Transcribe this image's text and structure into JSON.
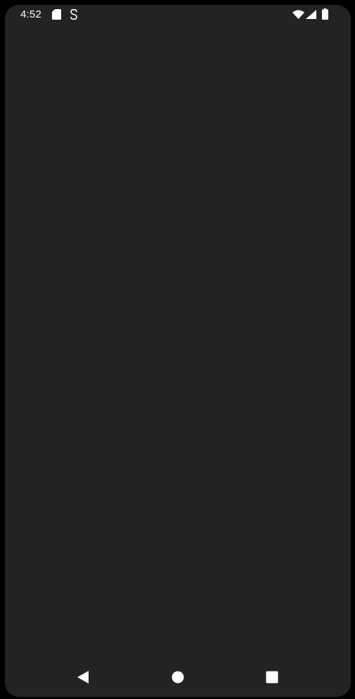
{
  "status_bar": {
    "time": "4:52",
    "left_icons": [
      "sd-card-icon",
      "sync-icon"
    ],
    "right_icons": [
      "wifi-icon",
      "cell-signal-icon",
      "battery-icon"
    ]
  },
  "nav_bar": {
    "buttons": [
      "back-icon",
      "home-icon",
      "recents-icon"
    ]
  },
  "colors": {
    "screen_background": "#232323",
    "frame": "#000000",
    "foreground": "#ffffff"
  }
}
